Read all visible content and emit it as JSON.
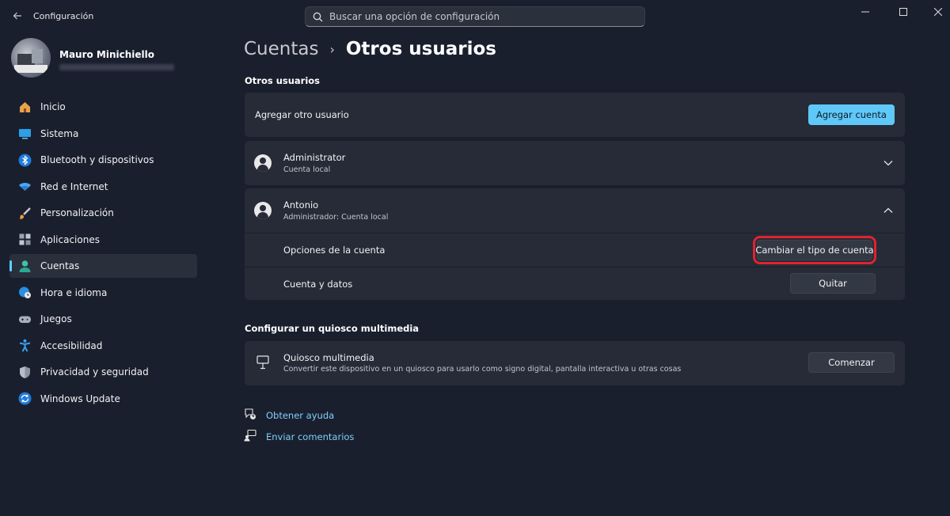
{
  "window": {
    "title": "Configuración"
  },
  "search": {
    "placeholder": "Buscar una opción de configuración"
  },
  "profile": {
    "name": "Mauro Minichiello"
  },
  "sidebar": {
    "items": [
      {
        "label": "Inicio",
        "icon": "home-icon"
      },
      {
        "label": "Sistema",
        "icon": "monitor-icon"
      },
      {
        "label": "Bluetooth y dispositivos",
        "icon": "bluetooth-icon"
      },
      {
        "label": "Red e Internet",
        "icon": "wifi-icon"
      },
      {
        "label": "Personalización",
        "icon": "brush-icon"
      },
      {
        "label": "Aplicaciones",
        "icon": "apps-icon"
      },
      {
        "label": "Cuentas",
        "icon": "person-icon",
        "active": true
      },
      {
        "label": "Hora e idioma",
        "icon": "globe-clock-icon"
      },
      {
        "label": "Juegos",
        "icon": "gamepad-icon"
      },
      {
        "label": "Accesibilidad",
        "icon": "accessibility-icon"
      },
      {
        "label": "Privacidad y seguridad",
        "icon": "shield-icon"
      },
      {
        "label": "Windows Update",
        "icon": "update-icon"
      }
    ]
  },
  "breadcrumb": {
    "parent": "Cuentas",
    "separator": "›",
    "current": "Otros usuarios"
  },
  "other_users": {
    "section_title": "Otros usuarios",
    "add_user_label": "Agregar otro usuario",
    "add_account_button": "Agregar cuenta",
    "users": [
      {
        "name": "Administrator",
        "type": "Cuenta local",
        "expanded": false
      },
      {
        "name": "Antonio",
        "type": "Administrador: Cuenta local",
        "expanded": true
      }
    ],
    "account_options_label": "Opciones de la cuenta",
    "change_type_button": "Cambiar el tipo de cuenta",
    "account_data_label": "Cuenta y datos",
    "remove_button": "Quitar"
  },
  "kiosk": {
    "section_title": "Configurar un quiosco multimedia",
    "title": "Quiosco multimedia",
    "description": "Convertir este dispositivo en un quiosco para usarlo como signo digital, pantalla interactiva u otras cosas",
    "start_button": "Comenzar"
  },
  "links": {
    "help": "Obtener ayuda",
    "feedback": "Enviar comentarios"
  },
  "colors": {
    "background": "#1a1f2e",
    "card": "#262b37",
    "accent": "#5fc8f8",
    "highlight_box": "#e0232e",
    "link": "#7fcffb"
  }
}
